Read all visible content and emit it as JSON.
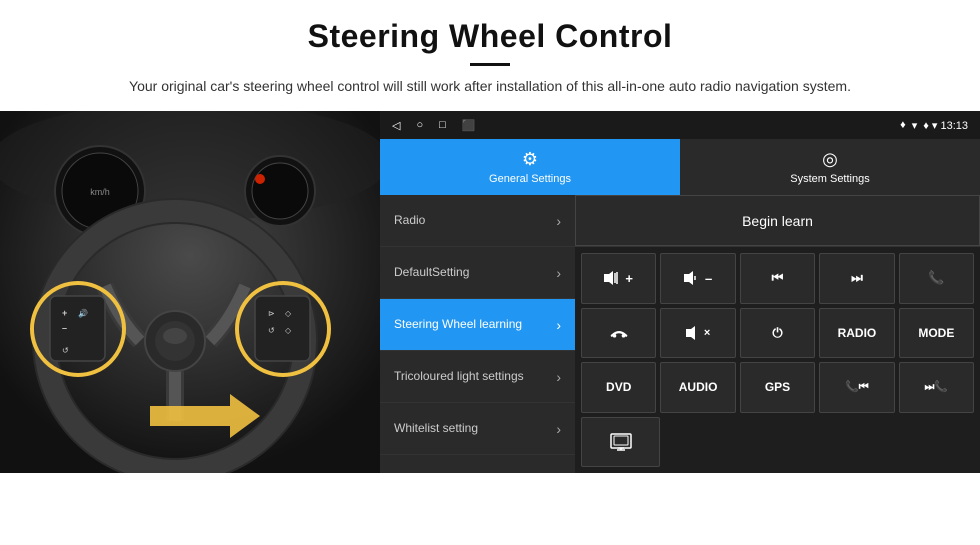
{
  "header": {
    "title": "Steering Wheel Control",
    "subtitle": "Your original car's steering wheel control will still work after installation of this all-in-one\nauto radio navigation system."
  },
  "status_bar": {
    "nav_icons": [
      "◁",
      "○",
      "□",
      "⬜"
    ],
    "right_icons": "♦ ▾ 13:13"
  },
  "tabs": [
    {
      "id": "general",
      "icon": "⚙",
      "label": "General Settings",
      "active": true
    },
    {
      "id": "system",
      "icon": "◎",
      "label": "System Settings",
      "active": false
    }
  ],
  "menu_items": [
    {
      "id": "radio",
      "label": "Radio",
      "active": false
    },
    {
      "id": "default_setting",
      "label": "DefaultSetting",
      "active": false
    },
    {
      "id": "steering_wheel",
      "label": "Steering Wheel learning",
      "active": true
    },
    {
      "id": "tricoloured",
      "label": "Tricoloured light settings",
      "active": false
    },
    {
      "id": "whitelist",
      "label": "Whitelist setting",
      "active": false
    }
  ],
  "begin_learn_label": "Begin learn",
  "control_buttons": {
    "row1": [
      "🔊+",
      "🔊–",
      "⏮",
      "⏭",
      "📞"
    ],
    "row2": [
      "📞",
      "🔇×",
      "⏻",
      "RADIO",
      "MODE"
    ],
    "row3": [
      "DVD",
      "AUDIO",
      "GPS",
      "📞⏮",
      "⏭📞"
    ]
  },
  "control_row4": [
    "🖼"
  ]
}
